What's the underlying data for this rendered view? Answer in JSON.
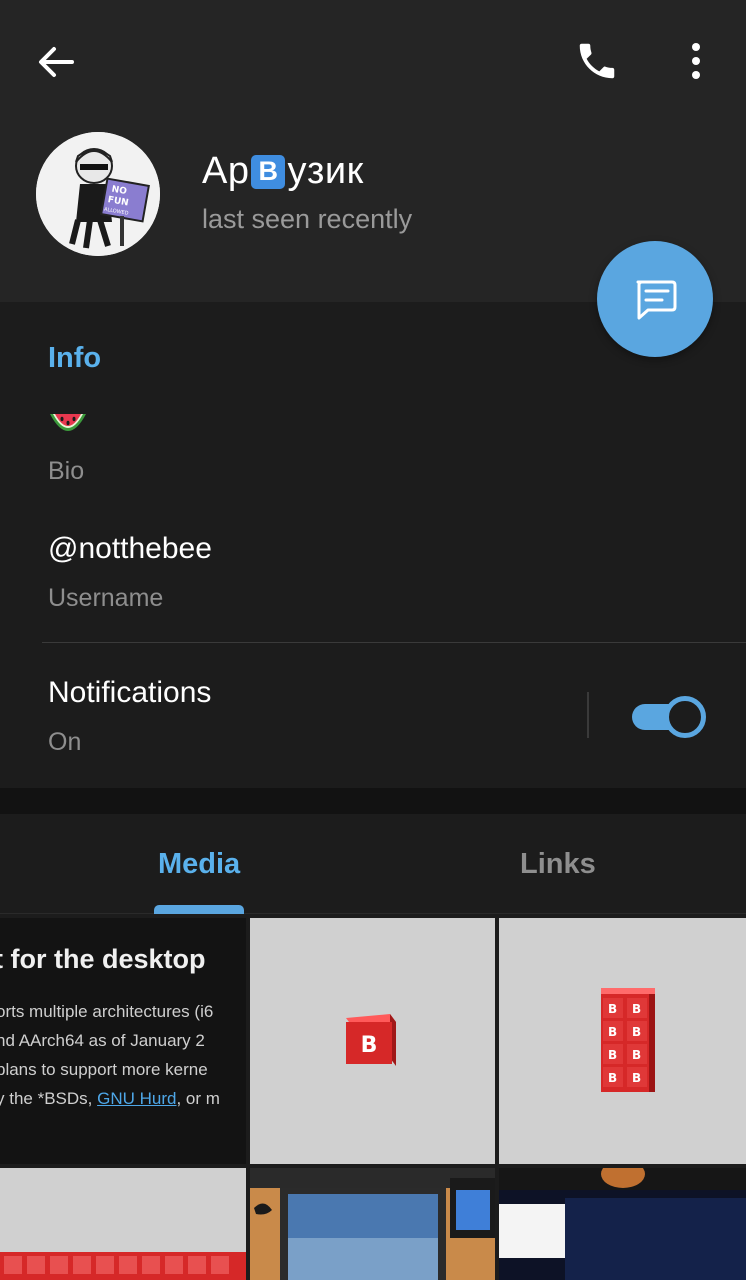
{
  "header": {
    "name_before": "Ар",
    "name_badge": "B",
    "name_after": "узик",
    "status": "last seen recently",
    "icons": [
      "arrow-left-icon",
      "phone-icon",
      "more-vertical-icon",
      "message-icon"
    ]
  },
  "info": {
    "section_title": "Info",
    "bio_value": "🍉",
    "bio_label": "Bio",
    "username_value": "@notthebee",
    "username_label": "Username",
    "notifications_label": "Notifications",
    "notifications_value": "On",
    "notifications_enabled": true
  },
  "tabs": [
    {
      "label": "Media",
      "active": true
    },
    {
      "label": "Links",
      "active": false
    }
  ],
  "media": {
    "doc_snippet": {
      "title": "t for the desktop",
      "lines": [
        "orts multiple architectures (i6",
        "nd AArch64 as of January 2",
        "plans to support more kerne"
      ],
      "line4_before": "y the *BSDs, ",
      "line4_link": "GNU Hurd",
      "line4_after": ", or m"
    },
    "cube_letter": "B"
  },
  "colors": {
    "accent": "#5aa6e0",
    "accent_text": "#5ab1ec",
    "header_bg": "#252525",
    "body_bg": "#1c1c1c",
    "secondary_text": "#8e8e8e"
  }
}
